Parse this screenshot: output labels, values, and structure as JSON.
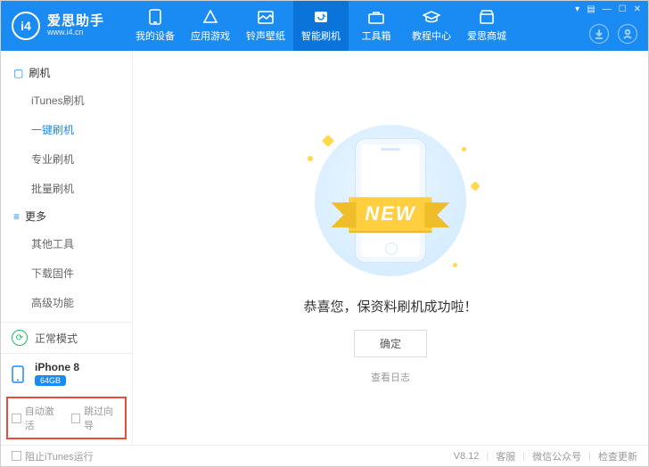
{
  "brand": {
    "name": "爱思助手",
    "url": "www.i4.cn",
    "logo_text": "i4"
  },
  "nav": [
    {
      "key": "device",
      "label": "我的设备"
    },
    {
      "key": "apps",
      "label": "应用游戏"
    },
    {
      "key": "ring",
      "label": "铃声壁纸"
    },
    {
      "key": "flash",
      "label": "智能刷机",
      "active": true
    },
    {
      "key": "tools",
      "label": "工具箱"
    },
    {
      "key": "tutor",
      "label": "教程中心"
    },
    {
      "key": "mall",
      "label": "爱思商城"
    }
  ],
  "sidebar": {
    "groups": [
      {
        "title": "刷机",
        "items": [
          {
            "key": "itunes",
            "label": "iTunes刷机"
          },
          {
            "key": "onekey",
            "label": "一键刷机",
            "selected": true
          },
          {
            "key": "pro",
            "label": "专业刷机"
          },
          {
            "key": "batch",
            "label": "批量刷机"
          }
        ]
      },
      {
        "title": "更多",
        "items": [
          {
            "key": "othertools",
            "label": "其他工具"
          },
          {
            "key": "downloadfw",
            "label": "下载固件"
          },
          {
            "key": "advanced",
            "label": "高级功能"
          }
        ]
      }
    ],
    "mode": "正常模式",
    "device": {
      "name": "iPhone 8",
      "storage": "64GB"
    },
    "auto_activate": "自动激活",
    "skip_guide": "跳过向导"
  },
  "main": {
    "ribbon": "NEW",
    "message": "恭喜您，保资料刷机成功啦！",
    "ok": "确定",
    "view_log": "查看日志"
  },
  "footer": {
    "block_itunes": "阻止iTunes运行",
    "version": "V8.12",
    "support": "客服",
    "wechat": "微信公众号",
    "update": "检查更新"
  }
}
